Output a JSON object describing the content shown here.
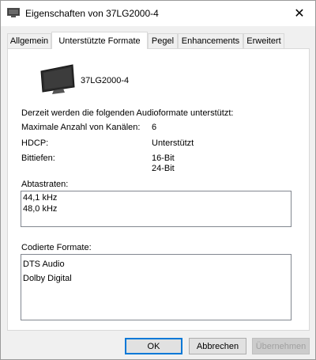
{
  "window": {
    "title": "Eigenschaften von 37LG2000-4",
    "close_symbol": "✕"
  },
  "tabs": [
    {
      "label": "Allgemein",
      "active": false
    },
    {
      "label": "Unterstützte Formate",
      "active": true
    },
    {
      "label": "Pegel",
      "active": false
    },
    {
      "label": "Enhancements",
      "active": false
    },
    {
      "label": "Erweitert",
      "active": false
    }
  ],
  "device": {
    "icon": "tv-monitor-icon",
    "name": "37LG2000-4"
  },
  "info": {
    "intro": "Derzeit werden die folgenden Audioformate unterstützt:",
    "rows": [
      {
        "label": "Maximale Anzahl von Kanälen:",
        "value": "6"
      },
      {
        "label": "HDCP:",
        "value": "Unterstützt"
      },
      {
        "label": "Bittiefen:",
        "value": "16-Bit",
        "value2": "24-Bit"
      }
    ]
  },
  "sample_rates": {
    "label": "Abtastraten:",
    "items": [
      "44,1 kHz",
      "48,0 kHz"
    ]
  },
  "encoded_formats": {
    "label": "Codierte Formate:",
    "items": [
      "DTS Audio",
      "Dolby Digital"
    ]
  },
  "buttons": {
    "ok": "OK",
    "cancel": "Abbrechen",
    "apply": "Übernehmen"
  },
  "colors": {
    "accent": "#0078d7",
    "disabled_text": "#a0a0a0"
  }
}
